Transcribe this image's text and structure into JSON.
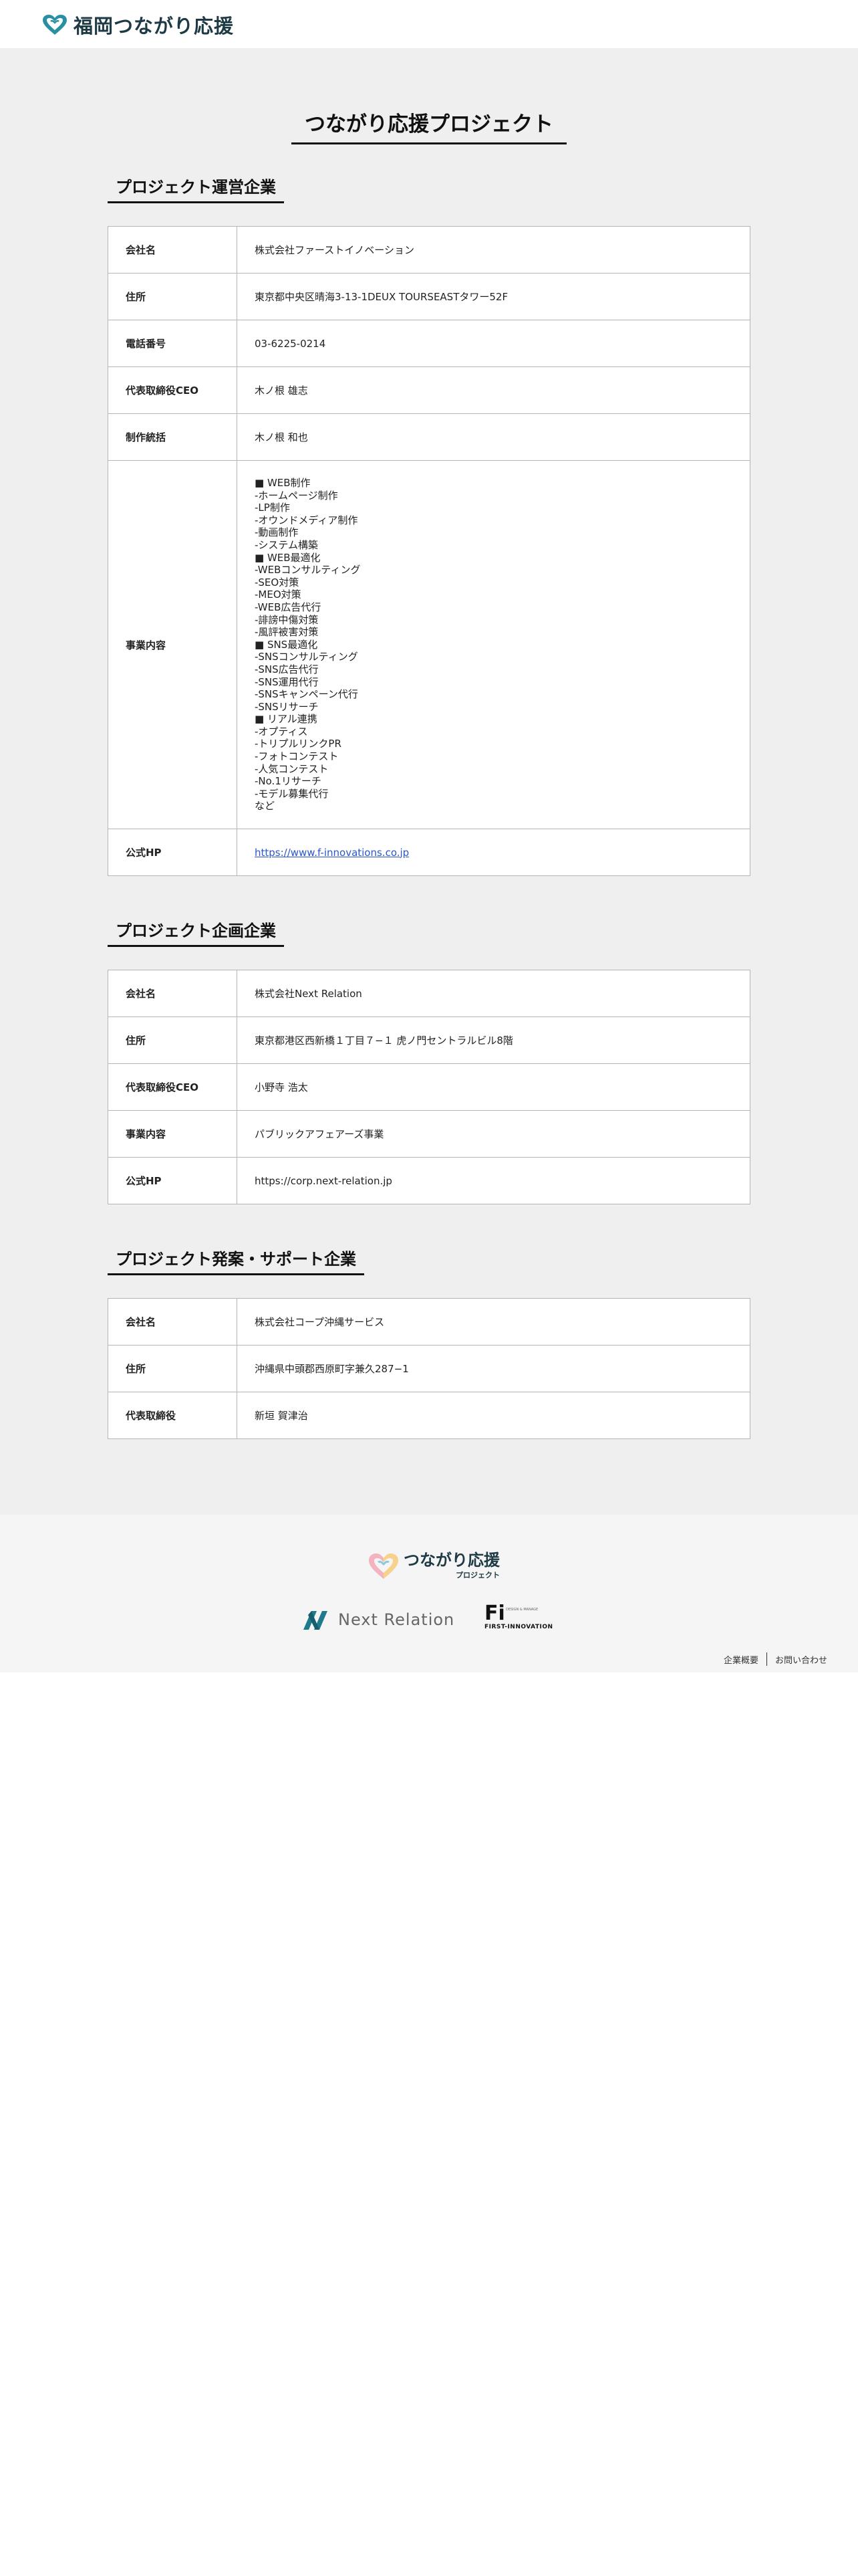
{
  "header": {
    "logo_text": "福岡つながり応援"
  },
  "page_title": "つながり応援プロジェクト",
  "sections": [
    {
      "heading": "プロジェクト運営企業",
      "rows": [
        {
          "key": "会社名",
          "value": "株式会社ファーストイノベーション"
        },
        {
          "key": "住所",
          "value": "東京都中央区晴海3-13-1DEUX TOURSEASTタワー52F"
        },
        {
          "key": "電話番号",
          "value": "03-6225-0214"
        },
        {
          "key": "代表取締役CEO",
          "value": "木ノ根 雄志"
        },
        {
          "key": "制作統括",
          "value": "木ノ根 和也"
        },
        {
          "key": "事業内容",
          "lines": [
            "■ WEB制作",
            "-ホームページ制作",
            "-LP制作",
            "-オウンドメディア制作",
            "-動画制作",
            "-システム構築",
            "■ WEB最適化",
            "-WEBコンサルティング",
            "-SEO対策",
            "-MEO対策",
            "-WEB広告代行",
            "-誹謗中傷対策",
            "-風評被害対策",
            "■ SNS最適化",
            "-SNSコンサルティング",
            "-SNS広告代行",
            "-SNS運用代行",
            "-SNSキャンペーン代行",
            "-SNSリサーチ",
            "■ リアル連携",
            "-オプティス",
            "-トリプルリンクPR",
            "-フォトコンテスト",
            "-人気コンテスト",
            "-No.1リサーチ",
            "-モデル募集代行",
            "など"
          ]
        },
        {
          "key": "公式HP",
          "link": "https://www.f-innovations.co.jp"
        }
      ]
    },
    {
      "heading": "プロジェクト企画企業",
      "rows": [
        {
          "key": "会社名",
          "value": "株式会社Next Relation"
        },
        {
          "key": "住所",
          "value": "東京都港区西新橋１丁目７−１ 虎ノ門セントラルビル8階"
        },
        {
          "key": "代表取締役CEO",
          "value": "小野寺 浩太"
        },
        {
          "key": "事業内容",
          "value": "パブリックアフェアーズ事業"
        },
        {
          "key": "公式HP",
          "value": "https://corp.next-relation.jp"
        }
      ]
    },
    {
      "heading": "プロジェクト発案・サポート企業",
      "rows": [
        {
          "key": "会社名",
          "value": "株式会社コープ沖縄サービス"
        },
        {
          "key": "住所",
          "value": "沖縄県中頭郡西原町字兼久287−1"
        },
        {
          "key": "代表取締役",
          "value": "新垣 賀津治"
        }
      ]
    }
  ],
  "footer": {
    "logo_text": "つながり応援",
    "logo_sub": "プロジェクト",
    "next_relation": "Next Relation",
    "fi_mark": "Fi",
    "fi_tag": "DESIGN & MANAGE",
    "fi_name": "FIRST-INNOVATION",
    "links": [
      "企業概要",
      "お問い合わせ"
    ]
  },
  "colors": {
    "accent": "#2a56c6",
    "brand_teal": "#1d3a45",
    "bg": "#efefef"
  }
}
